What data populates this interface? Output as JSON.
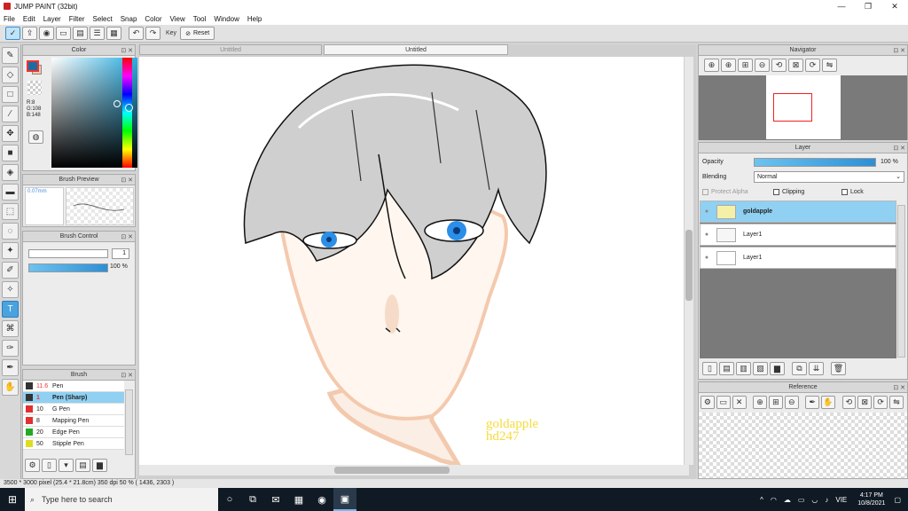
{
  "window": {
    "title": "JUMP PAINT (32bit)",
    "controls": [
      "—",
      "❐",
      "✕"
    ]
  },
  "menu": [
    "File",
    "Edit",
    "Layer",
    "Filter",
    "Select",
    "Snap",
    "Color",
    "View",
    "Tool",
    "Window",
    "Help"
  ],
  "toolbar": {
    "key_label": "Key",
    "reset_label": "Reset"
  },
  "panels": {
    "color": {
      "title": "Color",
      "rgb": "R:8\nG:108\nB:148"
    },
    "brush_preview": {
      "title": "Brush Preview",
      "size": "0.07mm"
    },
    "brush_control": {
      "title": "Brush Control",
      "size_value": "1",
      "opacity": "100 %"
    },
    "brush": {
      "title": "Brush",
      "items": [
        {
          "size": "11.6",
          "name": "Pen",
          "color": "#333333"
        },
        {
          "size": "1",
          "name": "Pen (Sharp)",
          "color": "#333333",
          "selected": true
        },
        {
          "size": "10",
          "name": "G Pen",
          "color": "#e03030"
        },
        {
          "size": "8",
          "name": "Mapping Pen",
          "color": "#e03030"
        },
        {
          "size": "20",
          "name": "Edge Pen",
          "color": "#22aa22"
        },
        {
          "size": "50",
          "name": "Stipple Pen",
          "color": "#dddd22"
        }
      ]
    },
    "navigator": {
      "title": "Navigator"
    },
    "layer": {
      "title": "Layer",
      "opacity_label": "Opacity",
      "opacity_value": "100 %",
      "blending_label": "Blending",
      "blending_value": "Normal",
      "protect_alpha": "Protect Alpha",
      "clipping": "Clipping",
      "lock": "Lock",
      "layers": [
        {
          "name": "goldapple",
          "selected": true
        },
        {
          "name": "Layer1",
          "selected": false
        },
        {
          "name": "Layer1",
          "selected": false
        }
      ]
    },
    "reference": {
      "title": "Reference"
    }
  },
  "tabs": [
    "Untitled",
    "Untitled"
  ],
  "canvas": {
    "signature_line1": "goldapple",
    "signature_line2": "hd247"
  },
  "status": {
    "text": "3500 * 3000 pixel  (25.4 * 21.8cm)  350 dpi  50 %  ( 1436, 2303 )"
  },
  "taskbar": {
    "search_placeholder": "Type here to search",
    "language": "VIE",
    "time": "4:17 PM",
    "date": "10/8/2021"
  },
  "colors": {
    "accent": "#4aa3df",
    "selected_row": "#8fd0f3",
    "taskbar": "#101a24"
  }
}
